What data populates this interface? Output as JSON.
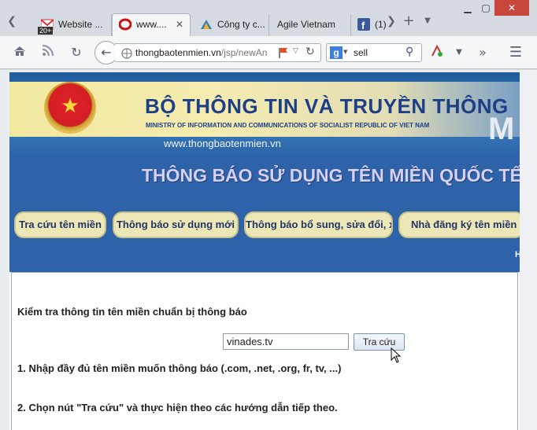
{
  "tabs": [
    {
      "label": "Website ...",
      "favicon": "gmail-icon",
      "badge": "20+"
    },
    {
      "label": "www....",
      "favicon": "red-circle-icon",
      "active": true
    },
    {
      "label": "Công ty c...",
      "favicon": "triangle-logo-icon"
    },
    {
      "label": "Agile Vietnam",
      "favicon": ""
    },
    {
      "label": "(1)",
      "favicon": "facebook-icon"
    }
  ],
  "url": {
    "host": "thongbaotenmien.vn",
    "path": "/jsp/newAn"
  },
  "search": {
    "value": "sell",
    "engine_icon": "google-icon"
  },
  "banner": {
    "ministry_vn": "BỘ THÔNG TIN VÀ TRUYỀN THÔNG",
    "ministry_en": "MINISTRY OF INFORMATION AND COMMUNICATIONS OF SOCIALIST REPUBLIC OF VIET NAM",
    "site_url": "www.thongbaotenmien.vn",
    "big_letter": "M"
  },
  "heading": "THÔNG BÁO SỬ DỤNG TÊN MIỀN QUỐC TẾ",
  "nav_pills": [
    "Tra cứu tên miền",
    "Thông báo sử dụng mới",
    "Thông báo bổ sung, sửa đổi, xóa",
    "Nhà đăng ký tên miền q"
  ],
  "stray_letter": "H",
  "form": {
    "title": "Kiểm tra thông tin tên miền chuẩn bị thông báo",
    "domain_value": "vinades.tv",
    "button_label": "Tra cứu"
  },
  "steps": [
    "1. Nhập đầy đủ tên miền muốn thông báo (.com, .net, .org, fr, tv, ...)",
    "2. Chọn nút \"Tra cứu\" và thực hiện theo các hướng dẫn tiếp theo."
  ],
  "colors": {
    "banner_blue": "#2f63a9",
    "heading_text": "#d8d0f4",
    "pill_bg": "#ece7b6",
    "ministry_text": "#1d3f86"
  }
}
